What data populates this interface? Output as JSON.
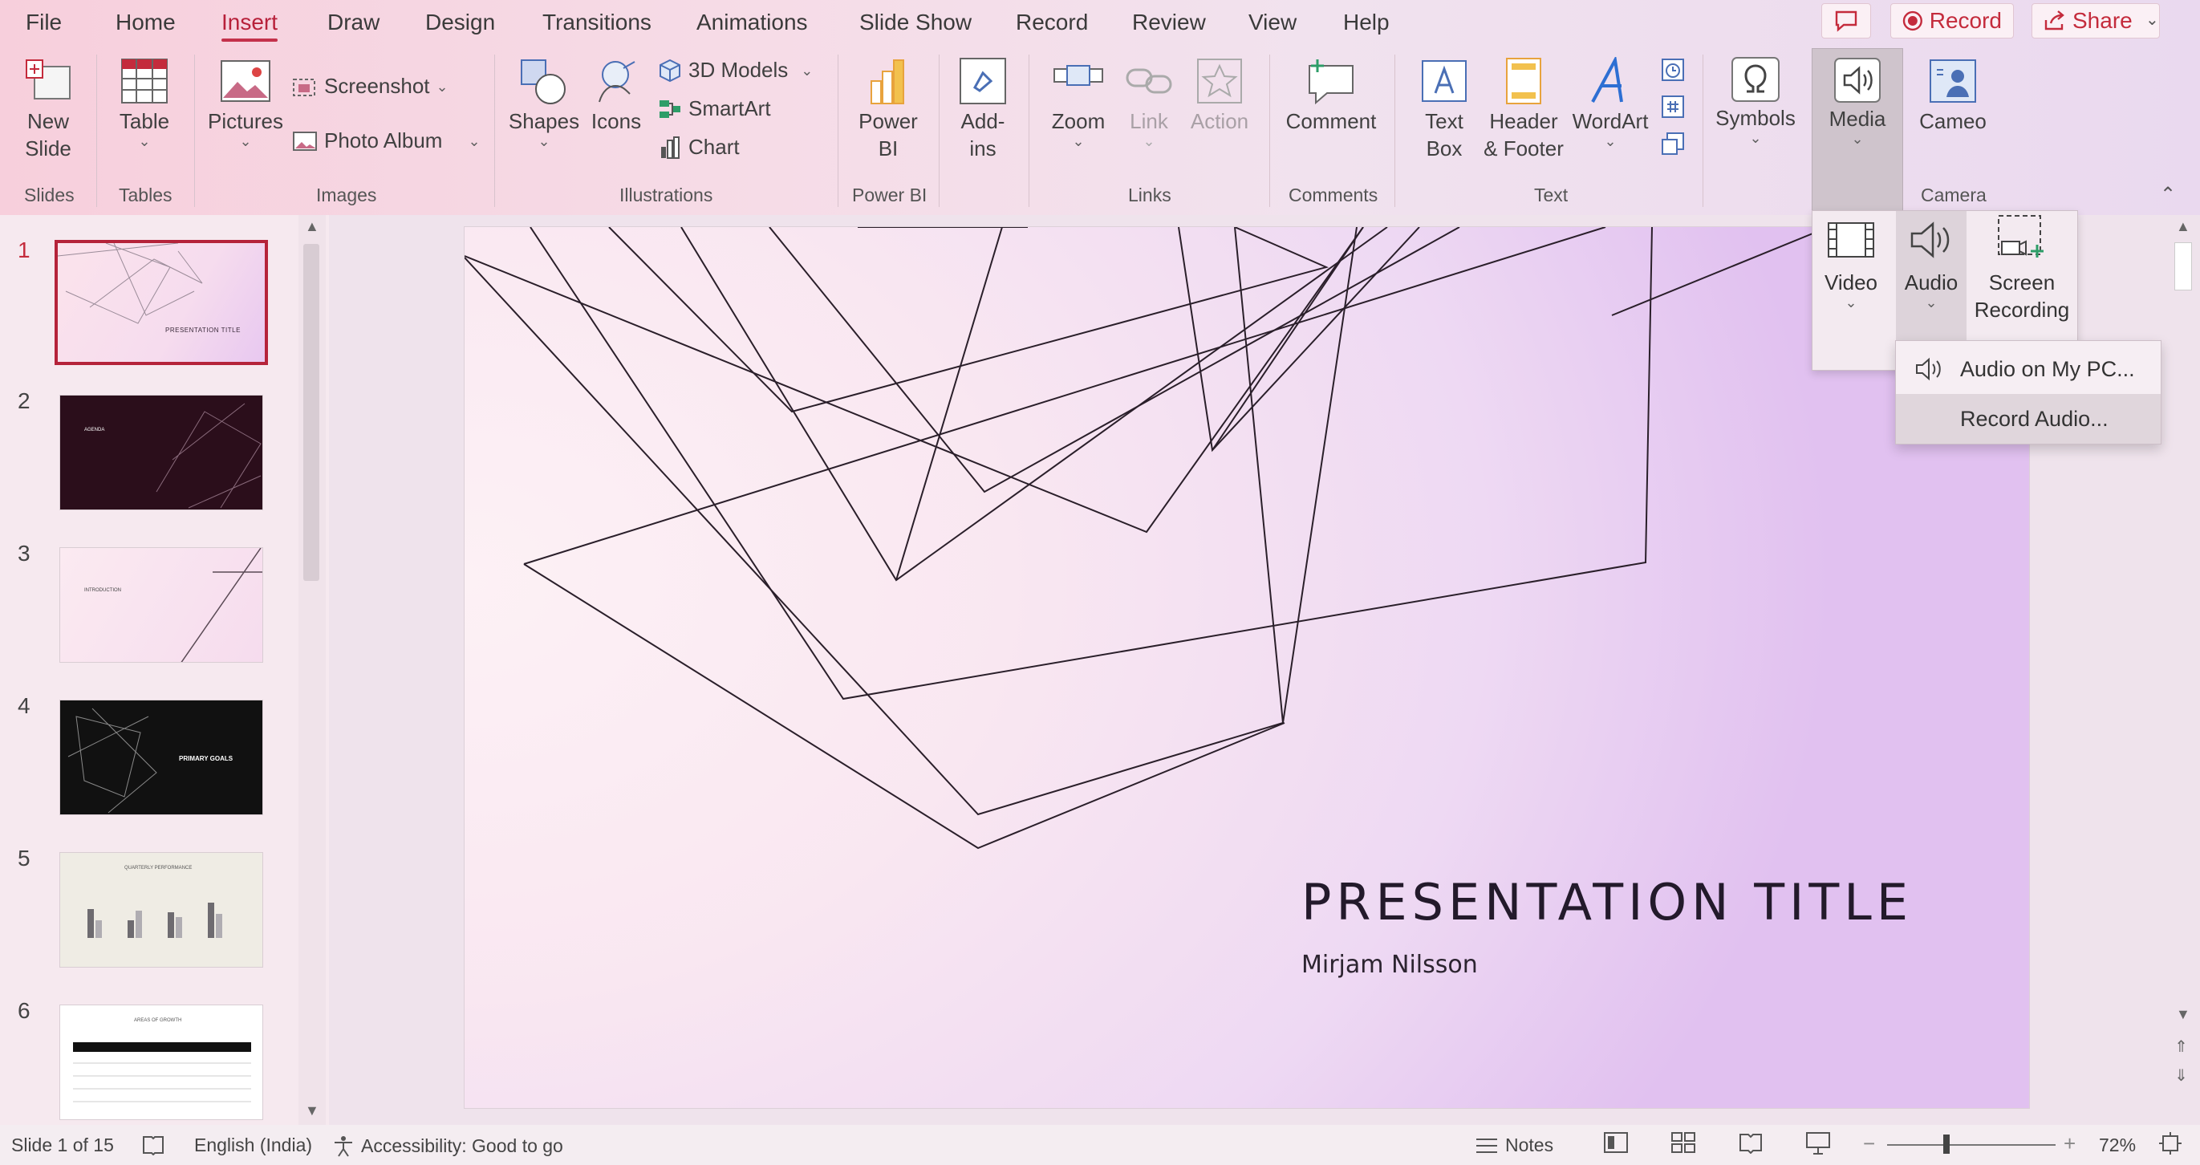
{
  "menu": {
    "tabs": [
      "File",
      "Home",
      "Insert",
      "Draw",
      "Design",
      "Transitions",
      "Animations",
      "Slide Show",
      "Record",
      "Review",
      "View",
      "Help"
    ],
    "active_tab": "Insert",
    "record_label": "Record",
    "share_label": "Share"
  },
  "ribbon": {
    "slides": {
      "new_slide": [
        "New",
        "Slide"
      ],
      "group": "Slides"
    },
    "tables": {
      "table": "Table",
      "group": "Tables"
    },
    "images": {
      "pictures": "Pictures",
      "screenshot": "Screenshot",
      "photo_album": "Photo Album",
      "group": "Images"
    },
    "illustrations": {
      "shapes": "Shapes",
      "icons": "Icons",
      "models_3d": "3D Models",
      "smartart": "SmartArt",
      "chart": "Chart",
      "group": "Illustrations"
    },
    "powerbi": {
      "label": [
        "Power",
        "BI"
      ],
      "group": "Power BI"
    },
    "addins": {
      "label": [
        "Add-",
        "ins"
      ]
    },
    "links": {
      "zoom": "Zoom",
      "link": "Link",
      "action": "Action",
      "group": "Links"
    },
    "comments": {
      "comment": "Comment",
      "group": "Comments"
    },
    "text": {
      "text_box": [
        "Text",
        "Box"
      ],
      "header_footer": [
        "Header",
        "& Footer"
      ],
      "wordart": "WordArt",
      "group": "Text"
    },
    "symbols": {
      "label": "Symbols"
    },
    "media": {
      "label": "Media"
    },
    "camera": {
      "cameo": "Cameo",
      "group": "Camera"
    }
  },
  "media_panel": {
    "video": "Video",
    "audio": "Audio",
    "screen_recording": [
      "Screen",
      "Recording"
    ]
  },
  "audio_menu": {
    "items": [
      "Audio on My PC...",
      "Record Audio..."
    ]
  },
  "slides": {
    "numbers": [
      "1",
      "2",
      "3",
      "4",
      "5",
      "6"
    ],
    "selected": 1,
    "thumb_texts": [
      "PRESENTATION TITLE",
      "AGENDA",
      "INTRODUCTION",
      "PRIMARY GOALS",
      "QUARTERLY PERFORMANCE",
      "AREAS OF GROWTH"
    ]
  },
  "slide": {
    "title": "PRESENTATION TITLE",
    "subtitle": "Mirjam Nilsson"
  },
  "status": {
    "slide_counter": "Slide 1 of 15",
    "language": "English (India)",
    "accessibility": "Accessibility: Good to go",
    "notes": "Notes",
    "zoom": "72%"
  },
  "colors": {
    "accent": "#c42b3c",
    "ribbon_bg": "#f7d6e2"
  }
}
